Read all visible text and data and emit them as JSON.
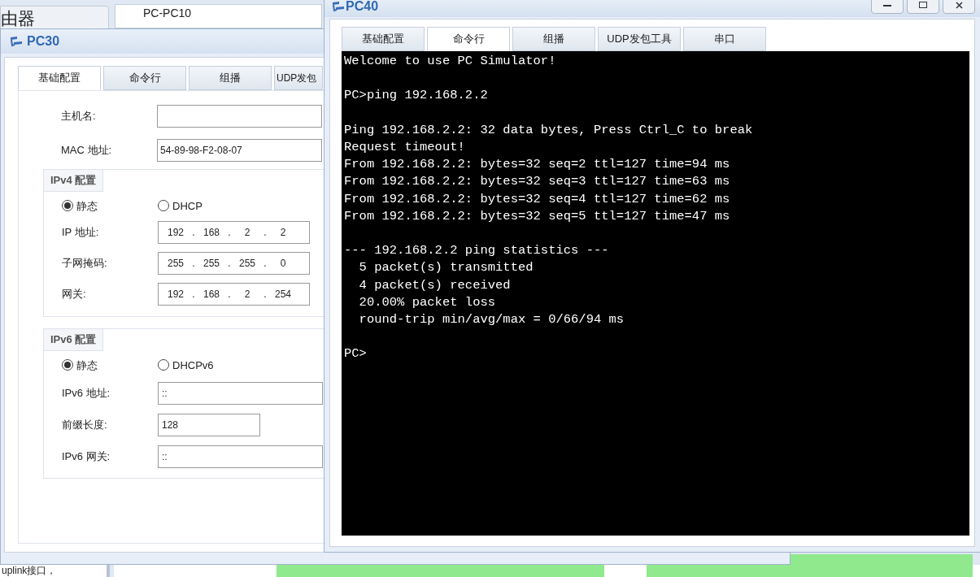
{
  "background": {
    "router_tab": "由器",
    "pc_tab": "PC-PC10",
    "bottom_text": "uplink接口，"
  },
  "pc30": {
    "title": "PC30",
    "tabs": [
      {
        "label": "基础配置",
        "selected": true
      },
      {
        "label": "命令行",
        "selected": false
      },
      {
        "label": "组播",
        "selected": false
      },
      {
        "label": "UDP发包",
        "selected": false
      }
    ],
    "host_name": {
      "label": "主机名:"
    },
    "mac": {
      "label": "MAC 地址:",
      "value": "54-89-98-F2-08-07"
    },
    "ipv4": {
      "title": "IPv4 配置",
      "modes": [
        {
          "label": "静态",
          "selected": true
        },
        {
          "label": "DHCP",
          "selected": false
        }
      ],
      "fields": [
        {
          "label": "IP 地址:",
          "octets": [
            "192",
            ".",
            "168",
            ".",
            "2",
            ".",
            "2"
          ]
        },
        {
          "label": "子网掩码:",
          "octets": [
            "255",
            ".",
            "255",
            ".",
            "255",
            ".",
            "0"
          ]
        },
        {
          "label": "网关:",
          "octets": [
            "192",
            ".",
            "168",
            ".",
            "2",
            ".",
            "254"
          ]
        }
      ]
    },
    "ipv6": {
      "title": "IPv6 配置",
      "modes": [
        {
          "label": "静态",
          "selected": true
        },
        {
          "label": "DHCPv6",
          "selected": false
        }
      ],
      "fields": [
        {
          "label": "IPv6 地址:",
          "value": "::",
          "kind": "wide"
        },
        {
          "label": "前缀长度:",
          "value": "128",
          "kind": "short"
        },
        {
          "label": "IPv6 网关:",
          "value": "::",
          "kind": "wide"
        }
      ]
    }
  },
  "pc40": {
    "title": "PC40",
    "tabs": [
      {
        "label": "基础配置",
        "selected": false
      },
      {
        "label": "命令行",
        "selected": true
      },
      {
        "label": "组播",
        "selected": false
      },
      {
        "label": "UDP发包工具",
        "selected": false
      },
      {
        "label": "串口",
        "selected": false
      }
    ],
    "terminal_blocks": [
      [
        "Welcome to use PC Simulator!"
      ],
      [
        "PC>ping 192.168.2.2"
      ],
      [
        "Ping 192.168.2.2: 32 data bytes, Press Ctrl_C to break",
        "Request timeout!",
        "From 192.168.2.2: bytes=32 seq=2 ttl=127 time=94 ms",
        "From 192.168.2.2: bytes=32 seq=3 ttl=127 time=63 ms",
        "From 192.168.2.2: bytes=32 seq=4 ttl=127 time=62 ms",
        "From 192.168.2.2: bytes=32 seq=5 ttl=127 time=47 ms"
      ],
      [
        "--- 192.168.2.2 ping statistics ---",
        "  5 packet(s) transmitted",
        "  4 packet(s) received",
        "  20.00% packet loss",
        "  round-trip min/avg/max = 0/66/94 ms"
      ],
      [
        "PC>"
      ]
    ]
  }
}
